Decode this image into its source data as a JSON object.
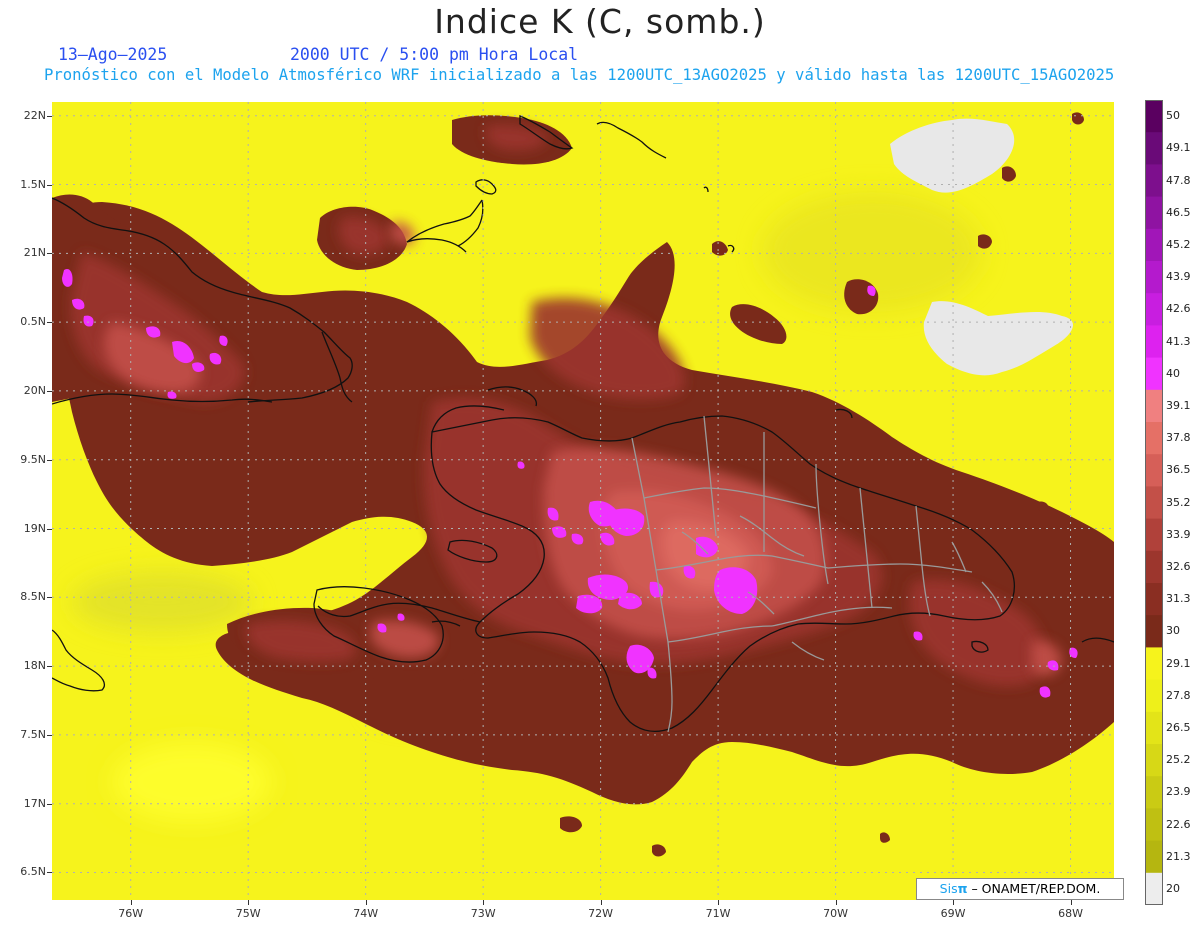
{
  "title": "Indice K (C, somb.)",
  "date_label": "13–Ago–2025",
  "time_label": "2000 UTC / 5:00 pm Hora Local",
  "forecast_line": "Pronóstico con el Modelo Atmosférico WRF inicializado a las 1200UTC_13AGO2025 y válido hasta las  1200UTC_15AGO2025",
  "credit": {
    "sis": "Sis",
    "pi": "π",
    "rest": "– ONAMET/REP.DOM."
  },
  "axes": {
    "lat_labels": [
      "22N",
      "1.5N",
      "21N",
      "0.5N",
      "20N",
      "9.5N",
      "19N",
      "8.5N",
      "18N",
      "7.5N",
      "17N",
      "6.5N"
    ],
    "lat_values": [
      22,
      21.5,
      21,
      20.5,
      20,
      19.5,
      19,
      18.5,
      18,
      17.5,
      17,
      16.5
    ],
    "lon_labels": [
      "76W",
      "75W",
      "74W",
      "73W",
      "72W",
      "71W",
      "70W",
      "69W",
      "68W"
    ],
    "lon_values": [
      -76,
      -75,
      -74,
      -73,
      -72,
      -71,
      -70,
      -69,
      -68
    ],
    "lat_range": [
      16.3,
      22.1
    ],
    "lon_range": [
      -76.67,
      -67.63
    ],
    "grid": "dotted"
  },
  "colorbar": {
    "labels": [
      "50",
      "49.1",
      "47.8",
      "46.5",
      "45.2",
      "43.9",
      "42.6",
      "41.3",
      "40",
      "39.1",
      "37.8",
      "36.5",
      "35.2",
      "33.9",
      "32.6",
      "31.3",
      "30",
      "29.1",
      "27.8",
      "26.5",
      "25.2",
      "23.9",
      "22.6",
      "21.3",
      "20"
    ],
    "colors": [
      "#5a0060",
      "#6a0a78",
      "#7d0f8d",
      "#8f13a2",
      "#a116b8",
      "#b41acd",
      "#c81ee0",
      "#dd22ef",
      "#f033ff",
      "#f08080",
      "#e57066",
      "#d65f58",
      "#c35048",
      "#b0413a",
      "#9c362d",
      "#8a2e22",
      "#7a2a1a",
      "#f6f31c",
      "#eef01a",
      "#e3e418",
      "#d7d816",
      "#cacb14",
      "#bfc012",
      "#b5b610",
      "#ededed"
    ]
  },
  "colors": {
    "land_outline": "#111111",
    "admin_boundaries": "#9a9a9a",
    "no_data": "#e8e8e8"
  }
}
